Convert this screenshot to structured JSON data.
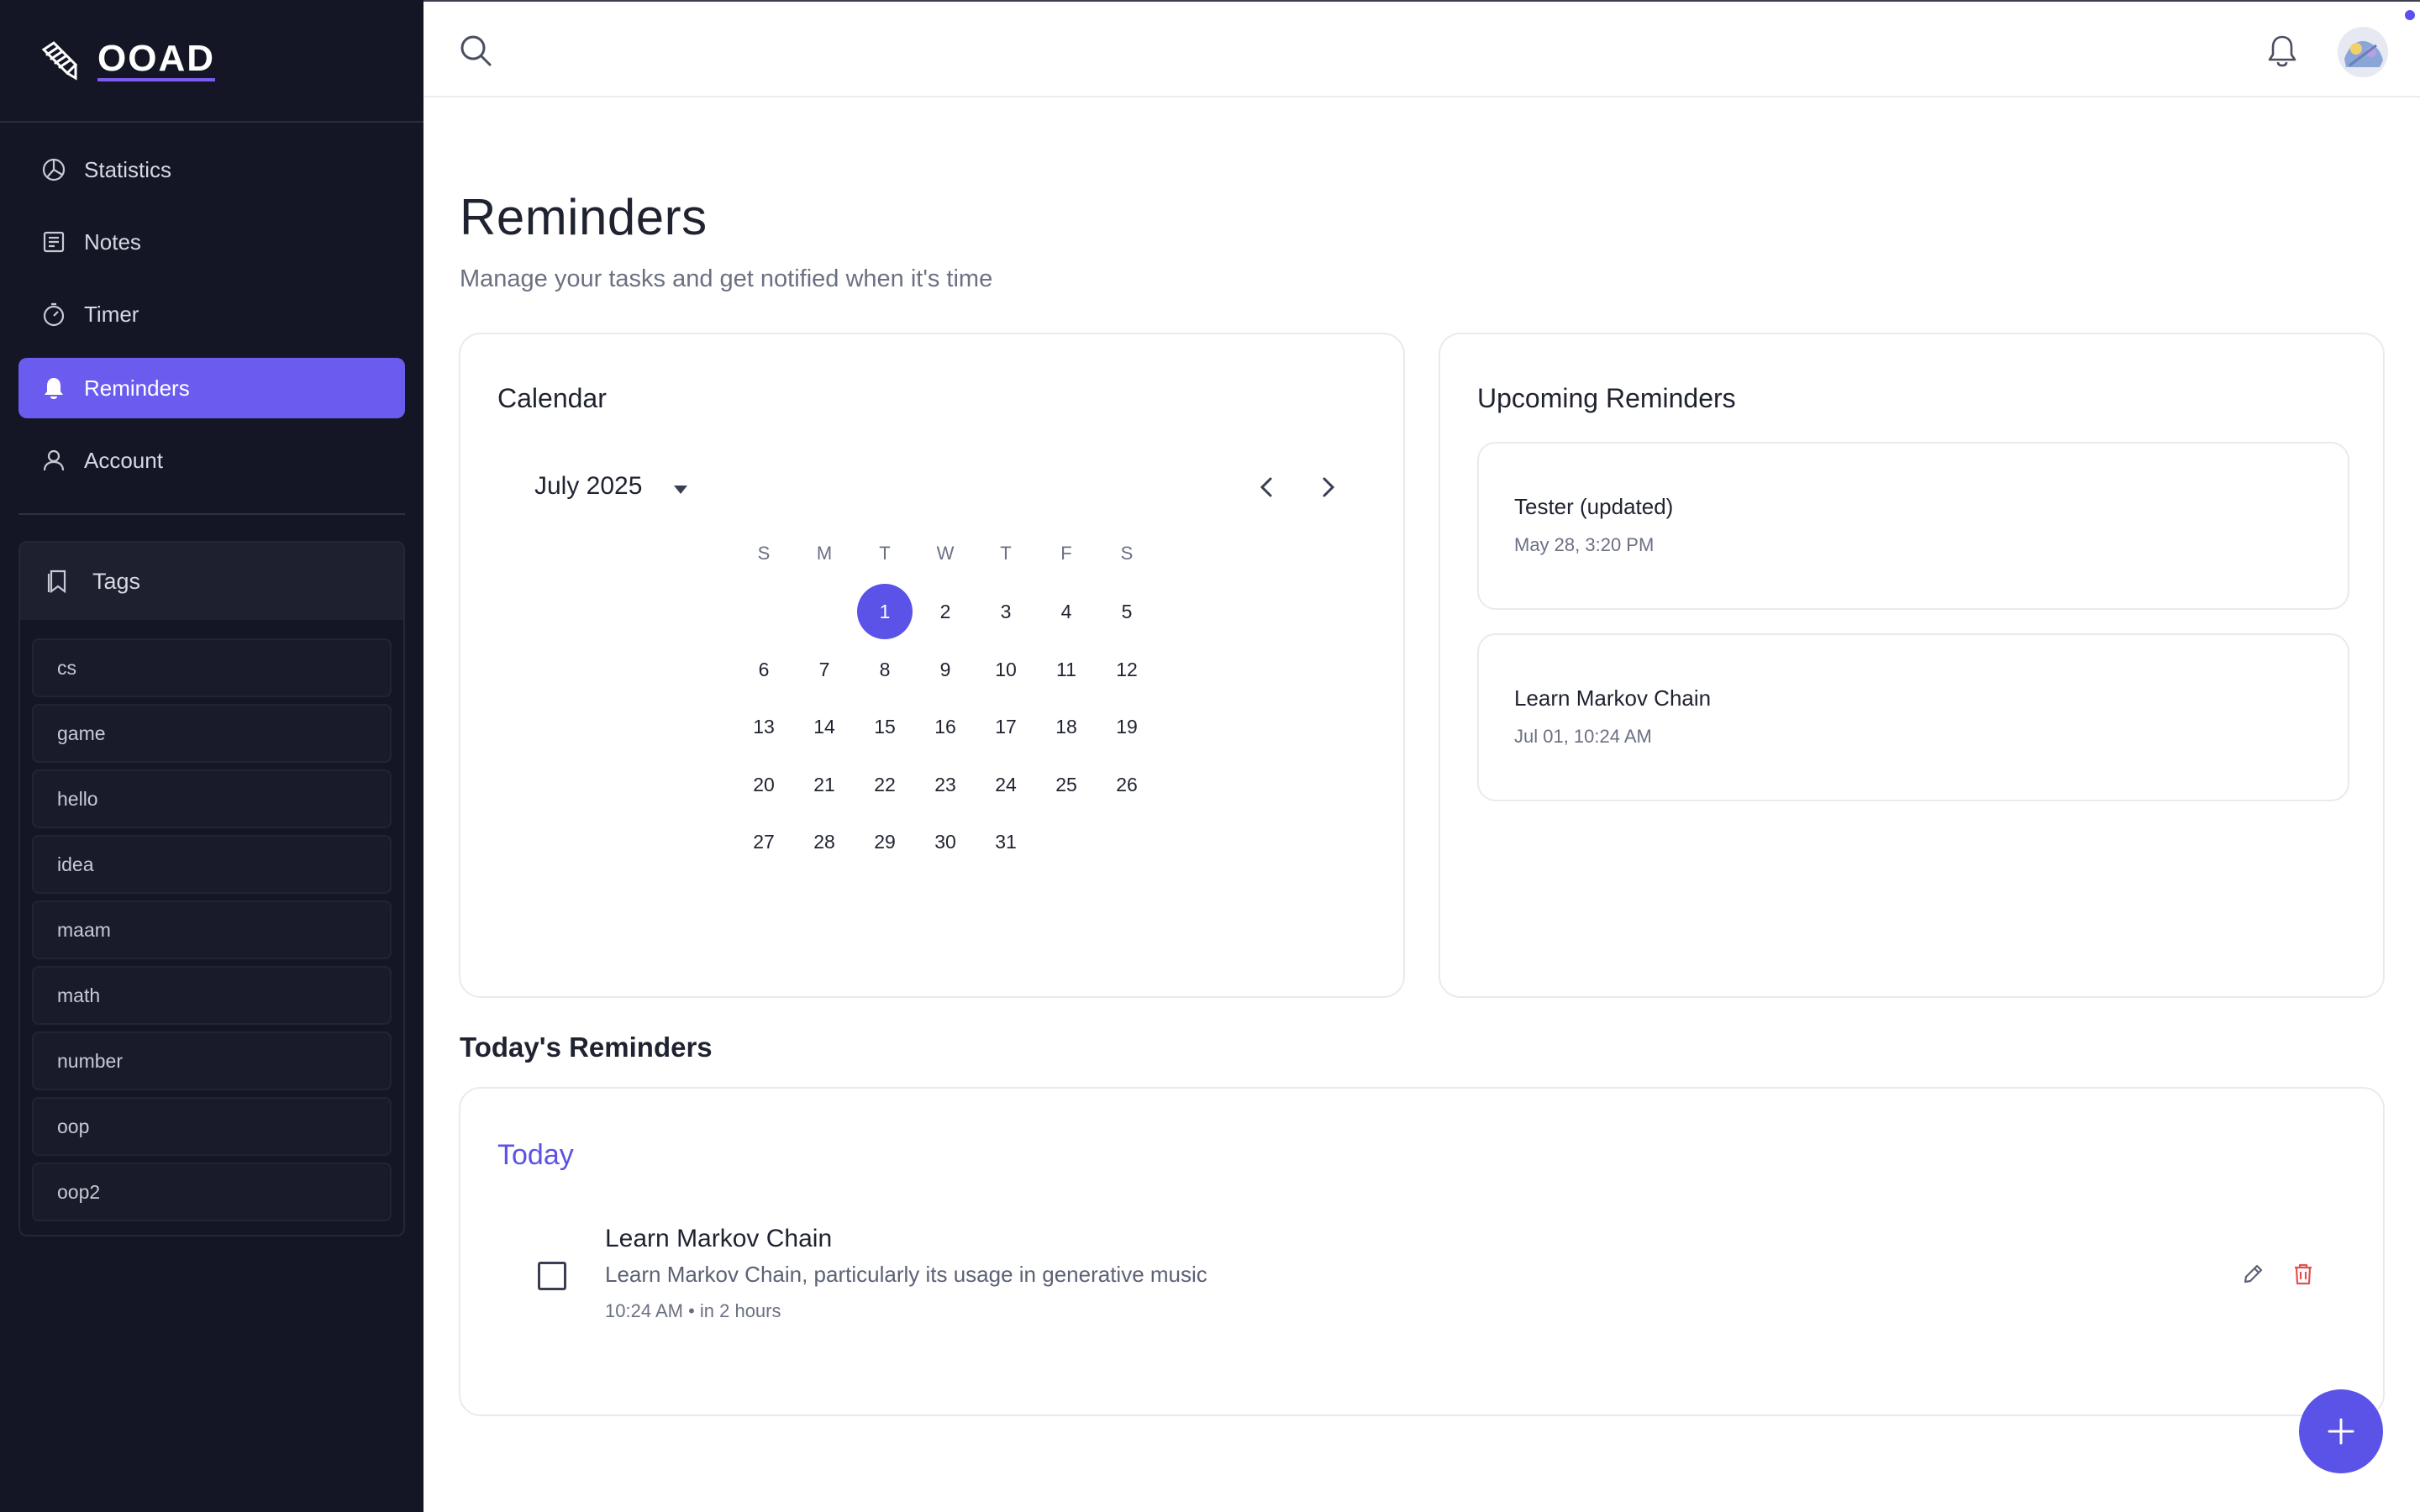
{
  "brand": {
    "name": "OOAD",
    "icon": "pencil-icon"
  },
  "sidebar": {
    "nav": [
      {
        "label": "Statistics",
        "icon": "pie-chart-icon"
      },
      {
        "label": "Notes",
        "icon": "notes-icon"
      },
      {
        "label": "Timer",
        "icon": "timer-icon"
      },
      {
        "label": "Reminders",
        "icon": "bell-icon",
        "active": true
      },
      {
        "label": "Account",
        "icon": "user-icon"
      }
    ],
    "tags_heading": "Tags",
    "tags": [
      "cs",
      "game",
      "hello",
      "idea",
      "maam",
      "math",
      "number",
      "oop",
      "oop2"
    ]
  },
  "topbar": {
    "search_icon": "search-icon",
    "bell_icon": "bell-icon",
    "avatar": "user-avatar"
  },
  "page": {
    "title": "Reminders",
    "subtitle": "Manage your tasks and get notified when it's time"
  },
  "calendar": {
    "title": "Calendar",
    "month": "July 2025",
    "weekdays": [
      "S",
      "M",
      "T",
      "W",
      "T",
      "F",
      "S"
    ],
    "days": [
      "1",
      "2",
      "3",
      "4",
      "5",
      "6",
      "7",
      "8",
      "9",
      "10",
      "11",
      "12",
      "13",
      "14",
      "15",
      "16",
      "17",
      "18",
      "19",
      "20",
      "21",
      "22",
      "23",
      "24",
      "25",
      "26",
      "27",
      "28",
      "29",
      "30",
      "31"
    ],
    "selected_day": "1"
  },
  "upcoming": {
    "title": "Upcoming Reminders",
    "items": [
      {
        "title": "Tester (updated)",
        "time": "May 28, 3:20 PM"
      },
      {
        "title": "Learn Markov Chain",
        "time": "Jul 01, 10:24 AM"
      }
    ]
  },
  "today": {
    "section_title": "Today's Reminders",
    "label": "Today",
    "task": {
      "title": "Learn Markov Chain",
      "description": "Learn Markov Chain, particularly its usage in generative music",
      "meta": "10:24 AM • in 2 hours"
    }
  },
  "colors": {
    "accent": "#5b52e8",
    "sidebar_bg": "#141625",
    "active_nav": "#6b5cf0",
    "delete": "#e0524f"
  }
}
